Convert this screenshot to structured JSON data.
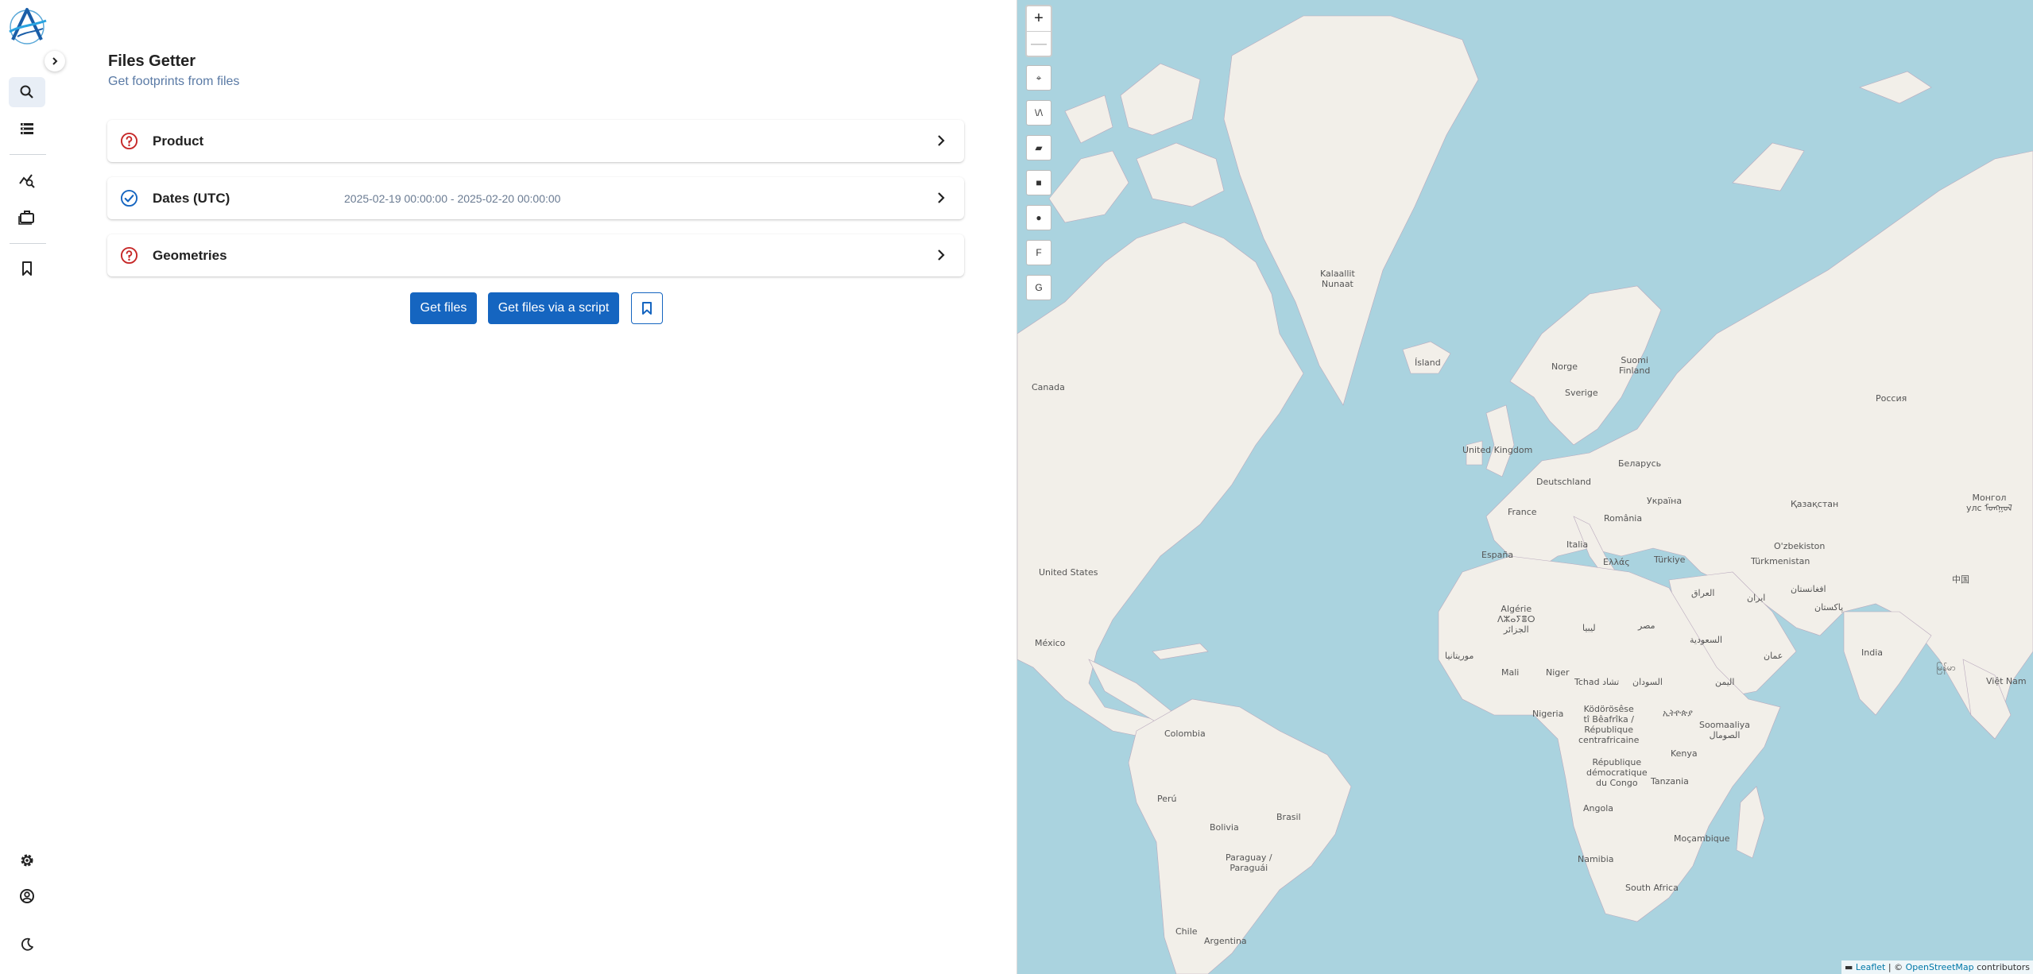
{
  "app": {
    "title": "Files Getter",
    "subtitle": "Get footprints from files",
    "accent_color": "#1565c0"
  },
  "sidebar": {
    "items": [
      {
        "icon": "search-icon",
        "active": true
      },
      {
        "icon": "list-icon",
        "active": false
      },
      {
        "icon": "analytics-icon",
        "active": false
      },
      {
        "icon": "briefcase-icon",
        "active": false
      },
      {
        "icon": "bookmark-icon",
        "active": false
      }
    ],
    "bottom_items": [
      {
        "icon": "gear-icon"
      },
      {
        "icon": "user-circle-icon"
      },
      {
        "icon": "moon-icon"
      }
    ]
  },
  "criteria": [
    {
      "title": "Product",
      "value": "",
      "state": "missing",
      "state_color": "#c62828"
    },
    {
      "title": "Dates (UTC)",
      "value": "2025-02-19 00:00:00 - 2025-02-20 00:00:00",
      "state": "ok",
      "state_color": "#1565c0"
    },
    {
      "title": "Geometries",
      "value": "",
      "state": "missing",
      "state_color": "#c62828"
    }
  ],
  "actions": {
    "get_files": "Get files",
    "get_files_script": "Get files via a script"
  },
  "map": {
    "zoom_in": "+",
    "zoom_out": "—",
    "tools": [
      "⌖",
      "\\/\\",
      "▰",
      "■",
      "●",
      "F",
      "G"
    ],
    "attribution": {
      "leaflet": "Leaflet",
      "sep": " | © ",
      "osm": "OpenStreetMap",
      "suffix": " contributors"
    },
    "labels": {
      "greenland": "Kalaallit\nNunaat",
      "iceland": "Ísland",
      "canada": "Canada",
      "norway": "Norge",
      "finland": "Suomi\nFinland",
      "sweden": "Sverige",
      "russia": "Россия",
      "uk": "United Kingdom",
      "belarus": "Беларусь",
      "germany": "Deutschland",
      "ukraine": "Україна",
      "kazakhstan": "Қазақстан",
      "mongolia": "Монгол\nулс ᠮᠣᠩᠭᠣᠯ",
      "france": "France",
      "romania": "România",
      "uzbekistan": "O'zbekiston",
      "turkmenistan": "Türkmenistan",
      "spain": "España",
      "italy": "Italia",
      "greece": "Ελλάς",
      "turkey": "Türkiye",
      "usa": "United States",
      "iraq": "العراق",
      "iran": "ایران",
      "afghanistan": "افغانستان",
      "pakistan": "پاکستان",
      "china": "中国",
      "algeria": "Algérie\nⴷⵣⴰⵢⴻⵔ\nالجزائر",
      "libya": "ليبيا",
      "egypt": "مصر",
      "saudi": "السعودية",
      "mexico": "México",
      "mauritania": "موريتانيا",
      "oman": "عمان",
      "india": "India",
      "mali": "Mali",
      "niger": "Niger",
      "chad": "Tchad تشاد",
      "sudan": "السودان",
      "yemen": "اليمن",
      "myanmar": "မြန်မာ",
      "vietnam": "Việt Nam",
      "car": "Ködörösêse\ntî Bêafrîka /\nRépublique\ncentrafricaine",
      "ethiopia": "ኢትዮጵያ",
      "somalia": "Soomaaliya\nالصومال",
      "nigeria": "Nigeria",
      "colombia": "Colombia",
      "kenya": "Kenya",
      "drc": "République\ndémocratique\ndu Congo",
      "tanzania": "Tanzania",
      "peru": "Perú",
      "brasil": "Brasil",
      "bolivia": "Bolivia",
      "angola": "Angola",
      "mozambique": "Moçambique",
      "paraguay": "Paraguay /\nParaguái",
      "namibia": "Namibia",
      "south_africa": "South Africa",
      "chile": "Chile",
      "argentina": "Argentina"
    }
  }
}
